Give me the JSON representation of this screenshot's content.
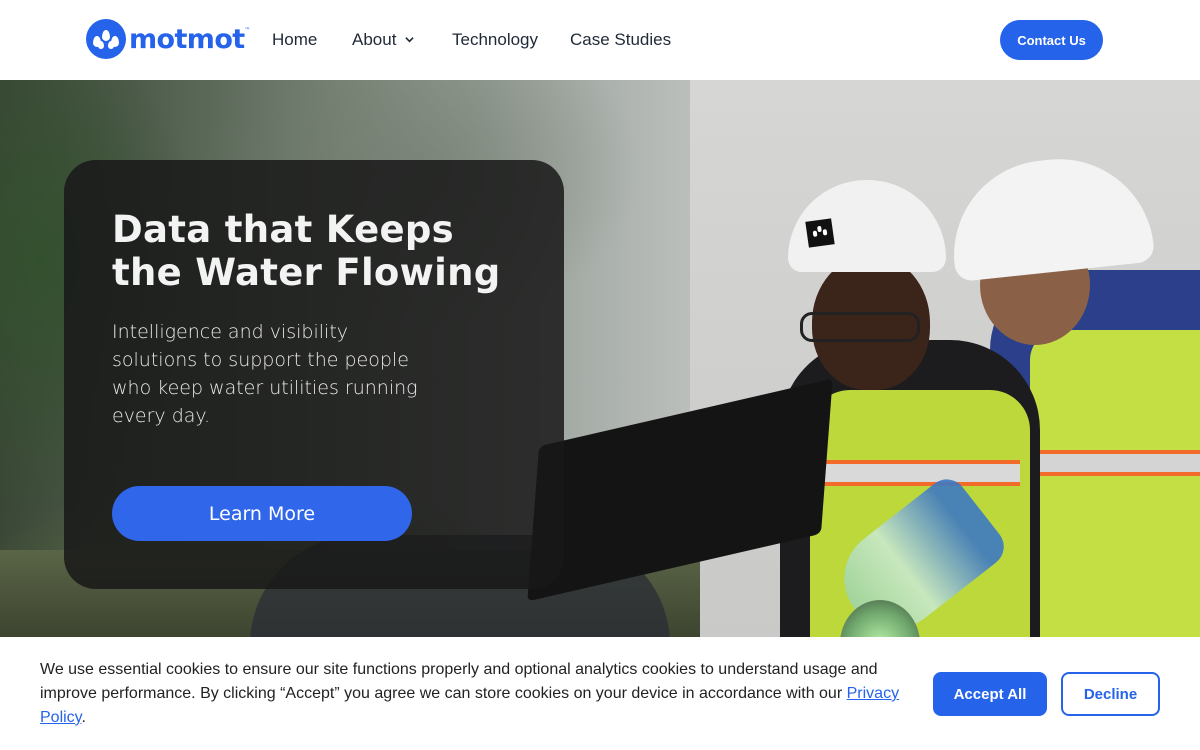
{
  "header": {
    "brand": "motmot",
    "brand_mark": "™",
    "nav": {
      "home": "Home",
      "about": "About",
      "technology": "Technology",
      "case_studies": "Case Studies"
    },
    "contact_label": "Contact Us"
  },
  "hero": {
    "title": "Data that Keeps the Water Flowing",
    "subtitle": "Intelligence and visibility solutions to support the people who keep water utilities running every day.",
    "cta_label": "Learn More"
  },
  "cookie_banner": {
    "text": "We use essential cookies to ensure our site functions properly and optional analytics cookies to understand usage and improve performance. By clicking “Accept” you agree we can store cookies on your device in accordance with our ",
    "policy_link": "Privacy Policy",
    "text_end": ".",
    "accept_label": "Accept All",
    "decline_label": "Decline"
  },
  "icons": {
    "logo": "water-drops-logo-icon",
    "about_dropdown": "chevron-down-icon"
  },
  "colors": {
    "brand_blue": "#2563eb",
    "card_overlay": "#181818",
    "text_dark": "#222222"
  }
}
